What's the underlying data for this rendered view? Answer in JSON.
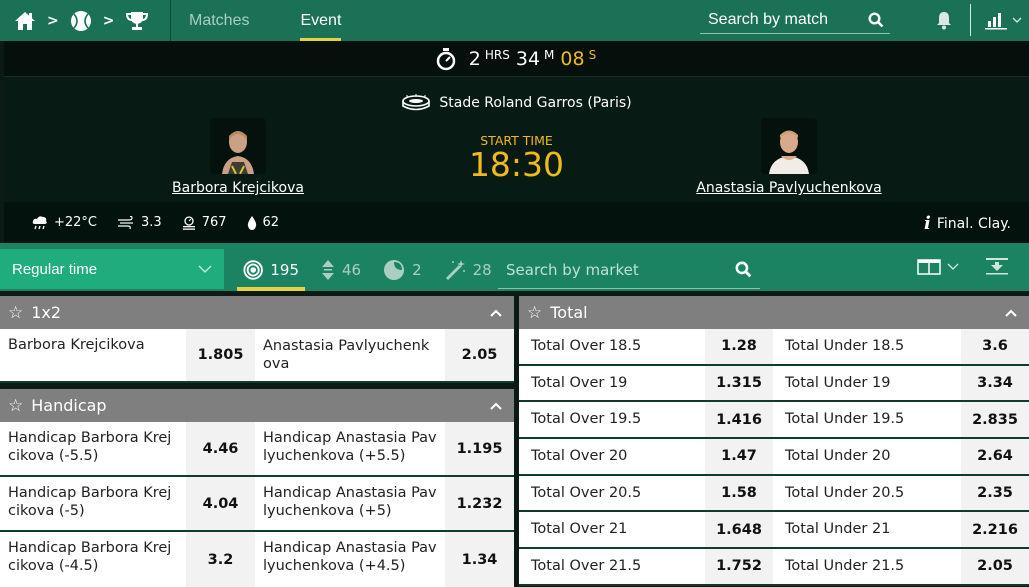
{
  "header": {
    "breadcrumb": [
      {
        "icon": "home-icon"
      },
      {
        "icon": "tennis-ball-icon"
      },
      {
        "icon": "trophy-icon"
      }
    ],
    "breadcrumb_separator": ">",
    "tabs": [
      {
        "label": "Matches",
        "active": false
      },
      {
        "label": "Event",
        "active": true
      }
    ],
    "search_placeholder": "Search by match",
    "icons": [
      "search-icon",
      "bell-icon",
      "stats-icon",
      "chevron-down-icon"
    ]
  },
  "event": {
    "countdown": {
      "hours": "2",
      "hours_unit": "HRS",
      "minutes": "34",
      "minutes_unit": "M",
      "seconds": "08",
      "seconds_unit": "S"
    },
    "venue": "Stade Roland Garros (Paris)",
    "start_time_label": "START TIME",
    "start_time": "18:30",
    "home_player": "Barbora Krejcikova",
    "away_player": "Anastasia Pavlyuchenkova",
    "weather": {
      "temperature": "+22°C",
      "wind": "3.3",
      "pressure": "767",
      "humidity": "62"
    },
    "info": "Final. Clay."
  },
  "market_bar": {
    "period": "Regular time",
    "filters": [
      {
        "icon": "target-icon",
        "count": "195",
        "active": true
      },
      {
        "icon": "updown-icon",
        "count": "46",
        "active": false
      },
      {
        "icon": "live-icon",
        "count": "2",
        "active": false
      },
      {
        "icon": "magic-wand-icon",
        "count": "28",
        "active": false
      }
    ],
    "search_placeholder": "Search by market"
  },
  "markets": {
    "x12": {
      "title": "1x2",
      "rows": [
        {
          "left_label": "Barbora Krejcikova",
          "left_odd": "1.805",
          "right_label": "Anastasia Pavlyuchenkova",
          "right_odd": "2.05"
        }
      ]
    },
    "handicap": {
      "title": "Handicap",
      "rows": [
        {
          "left_label": "Handicap Barbora Krejcikova (-5.5)",
          "left_odd": "4.46",
          "right_label": "Handicap Anastasia Pavlyuchenkova (+5.5)",
          "right_odd": "1.195"
        },
        {
          "left_label": "Handicap Barbora Krejcikova (-5)",
          "left_odd": "4.04",
          "right_label": "Handicap Anastasia Pavlyuchenkova (+5)",
          "right_odd": "1.232"
        },
        {
          "left_label": "Handicap Barbora Krejcikova (-4.5)",
          "left_odd": "3.2",
          "right_label": "Handicap Anastasia Pavlyuchenkova (+4.5)",
          "right_odd": "1.34"
        }
      ]
    },
    "total": {
      "title": "Total",
      "rows": [
        {
          "left_label": "Total Over 18.5",
          "left_odd": "1.28",
          "right_label": "Total Under 18.5",
          "right_odd": "3.6"
        },
        {
          "left_label": "Total Over 19",
          "left_odd": "1.315",
          "right_label": "Total Under 19",
          "right_odd": "3.34"
        },
        {
          "left_label": "Total Over 19.5",
          "left_odd": "1.416",
          "right_label": "Total Under 19.5",
          "right_odd": "2.835"
        },
        {
          "left_label": "Total Over 20",
          "left_odd": "1.47",
          "right_label": "Total Under 20",
          "right_odd": "2.64"
        },
        {
          "left_label": "Total Over 20.5",
          "left_odd": "1.58",
          "right_label": "Total Under 20.5",
          "right_odd": "2.35"
        },
        {
          "left_label": "Total Over 21",
          "left_odd": "1.648",
          "right_label": "Total Under 21",
          "right_odd": "2.216"
        },
        {
          "left_label": "Total Over 21.5",
          "left_odd": "1.752",
          "right_label": "Total Under 21.5",
          "right_odd": "2.05"
        }
      ]
    }
  }
}
